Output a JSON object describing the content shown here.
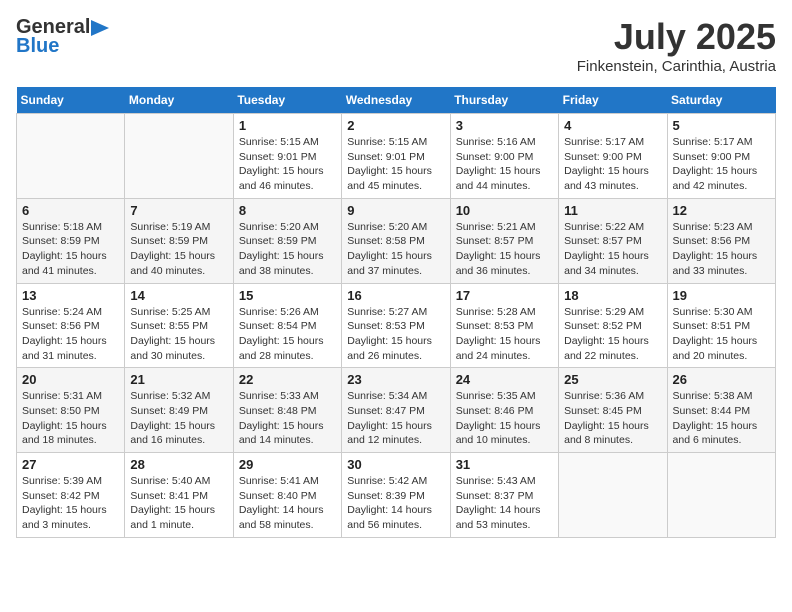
{
  "header": {
    "logo_general": "General",
    "logo_blue": "Blue",
    "month_title": "July 2025",
    "location": "Finkenstein, Carinthia, Austria"
  },
  "weekdays": [
    "Sunday",
    "Monday",
    "Tuesday",
    "Wednesday",
    "Thursday",
    "Friday",
    "Saturday"
  ],
  "weeks": [
    [
      {
        "day": "",
        "sunrise": "",
        "sunset": "",
        "daylight": ""
      },
      {
        "day": "",
        "sunrise": "",
        "sunset": "",
        "daylight": ""
      },
      {
        "day": "1",
        "sunrise": "Sunrise: 5:15 AM",
        "sunset": "Sunset: 9:01 PM",
        "daylight": "Daylight: 15 hours and 46 minutes."
      },
      {
        "day": "2",
        "sunrise": "Sunrise: 5:15 AM",
        "sunset": "Sunset: 9:01 PM",
        "daylight": "Daylight: 15 hours and 45 minutes."
      },
      {
        "day": "3",
        "sunrise": "Sunrise: 5:16 AM",
        "sunset": "Sunset: 9:00 PM",
        "daylight": "Daylight: 15 hours and 44 minutes."
      },
      {
        "day": "4",
        "sunrise": "Sunrise: 5:17 AM",
        "sunset": "Sunset: 9:00 PM",
        "daylight": "Daylight: 15 hours and 43 minutes."
      },
      {
        "day": "5",
        "sunrise": "Sunrise: 5:17 AM",
        "sunset": "Sunset: 9:00 PM",
        "daylight": "Daylight: 15 hours and 42 minutes."
      }
    ],
    [
      {
        "day": "6",
        "sunrise": "Sunrise: 5:18 AM",
        "sunset": "Sunset: 8:59 PM",
        "daylight": "Daylight: 15 hours and 41 minutes."
      },
      {
        "day": "7",
        "sunrise": "Sunrise: 5:19 AM",
        "sunset": "Sunset: 8:59 PM",
        "daylight": "Daylight: 15 hours and 40 minutes."
      },
      {
        "day": "8",
        "sunrise": "Sunrise: 5:20 AM",
        "sunset": "Sunset: 8:59 PM",
        "daylight": "Daylight: 15 hours and 38 minutes."
      },
      {
        "day": "9",
        "sunrise": "Sunrise: 5:20 AM",
        "sunset": "Sunset: 8:58 PM",
        "daylight": "Daylight: 15 hours and 37 minutes."
      },
      {
        "day": "10",
        "sunrise": "Sunrise: 5:21 AM",
        "sunset": "Sunset: 8:57 PM",
        "daylight": "Daylight: 15 hours and 36 minutes."
      },
      {
        "day": "11",
        "sunrise": "Sunrise: 5:22 AM",
        "sunset": "Sunset: 8:57 PM",
        "daylight": "Daylight: 15 hours and 34 minutes."
      },
      {
        "day": "12",
        "sunrise": "Sunrise: 5:23 AM",
        "sunset": "Sunset: 8:56 PM",
        "daylight": "Daylight: 15 hours and 33 minutes."
      }
    ],
    [
      {
        "day": "13",
        "sunrise": "Sunrise: 5:24 AM",
        "sunset": "Sunset: 8:56 PM",
        "daylight": "Daylight: 15 hours and 31 minutes."
      },
      {
        "day": "14",
        "sunrise": "Sunrise: 5:25 AM",
        "sunset": "Sunset: 8:55 PM",
        "daylight": "Daylight: 15 hours and 30 minutes."
      },
      {
        "day": "15",
        "sunrise": "Sunrise: 5:26 AM",
        "sunset": "Sunset: 8:54 PM",
        "daylight": "Daylight: 15 hours and 28 minutes."
      },
      {
        "day": "16",
        "sunrise": "Sunrise: 5:27 AM",
        "sunset": "Sunset: 8:53 PM",
        "daylight": "Daylight: 15 hours and 26 minutes."
      },
      {
        "day": "17",
        "sunrise": "Sunrise: 5:28 AM",
        "sunset": "Sunset: 8:53 PM",
        "daylight": "Daylight: 15 hours and 24 minutes."
      },
      {
        "day": "18",
        "sunrise": "Sunrise: 5:29 AM",
        "sunset": "Sunset: 8:52 PM",
        "daylight": "Daylight: 15 hours and 22 minutes."
      },
      {
        "day": "19",
        "sunrise": "Sunrise: 5:30 AM",
        "sunset": "Sunset: 8:51 PM",
        "daylight": "Daylight: 15 hours and 20 minutes."
      }
    ],
    [
      {
        "day": "20",
        "sunrise": "Sunrise: 5:31 AM",
        "sunset": "Sunset: 8:50 PM",
        "daylight": "Daylight: 15 hours and 18 minutes."
      },
      {
        "day": "21",
        "sunrise": "Sunrise: 5:32 AM",
        "sunset": "Sunset: 8:49 PM",
        "daylight": "Daylight: 15 hours and 16 minutes."
      },
      {
        "day": "22",
        "sunrise": "Sunrise: 5:33 AM",
        "sunset": "Sunset: 8:48 PM",
        "daylight": "Daylight: 15 hours and 14 minutes."
      },
      {
        "day": "23",
        "sunrise": "Sunrise: 5:34 AM",
        "sunset": "Sunset: 8:47 PM",
        "daylight": "Daylight: 15 hours and 12 minutes."
      },
      {
        "day": "24",
        "sunrise": "Sunrise: 5:35 AM",
        "sunset": "Sunset: 8:46 PM",
        "daylight": "Daylight: 15 hours and 10 minutes."
      },
      {
        "day": "25",
        "sunrise": "Sunrise: 5:36 AM",
        "sunset": "Sunset: 8:45 PM",
        "daylight": "Daylight: 15 hours and 8 minutes."
      },
      {
        "day": "26",
        "sunrise": "Sunrise: 5:38 AM",
        "sunset": "Sunset: 8:44 PM",
        "daylight": "Daylight: 15 hours and 6 minutes."
      }
    ],
    [
      {
        "day": "27",
        "sunrise": "Sunrise: 5:39 AM",
        "sunset": "Sunset: 8:42 PM",
        "daylight": "Daylight: 15 hours and 3 minutes."
      },
      {
        "day": "28",
        "sunrise": "Sunrise: 5:40 AM",
        "sunset": "Sunset: 8:41 PM",
        "daylight": "Daylight: 15 hours and 1 minute."
      },
      {
        "day": "29",
        "sunrise": "Sunrise: 5:41 AM",
        "sunset": "Sunset: 8:40 PM",
        "daylight": "Daylight: 14 hours and 58 minutes."
      },
      {
        "day": "30",
        "sunrise": "Sunrise: 5:42 AM",
        "sunset": "Sunset: 8:39 PM",
        "daylight": "Daylight: 14 hours and 56 minutes."
      },
      {
        "day": "31",
        "sunrise": "Sunrise: 5:43 AM",
        "sunset": "Sunset: 8:37 PM",
        "daylight": "Daylight: 14 hours and 53 minutes."
      },
      {
        "day": "",
        "sunrise": "",
        "sunset": "",
        "daylight": ""
      },
      {
        "day": "",
        "sunrise": "",
        "sunset": "",
        "daylight": ""
      }
    ]
  ]
}
